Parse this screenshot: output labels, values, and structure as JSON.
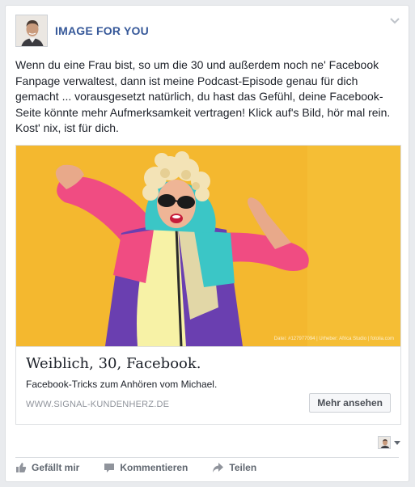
{
  "post": {
    "page_name": "IMAGE FOR YOU",
    "text": "Wenn du eine Frau bist, so um die 30 und außerdem noch ne' Facebook Fanpage verwaltest, dann ist meine Podcast-Episode genau für dich gemacht ... vorausgesetzt natürlich, du hast das Gefühl, deine Facebook-Seite könnte mehr Aufmerksamkeit vertragen! Klick auf's Bild, hör mal rein. Kost' nix, ist für dich."
  },
  "attachment": {
    "image_credit": "Datei: #127977094 | Urheber: Africa Studio | fotolia.com",
    "title": "Weiblich, 30, Facebook.",
    "description": "Facebook-Tricks zum Anhören vom Michael.",
    "domain": "WWW.SIGNAL-KUNDENHERZ.DE",
    "cta_label": "Mehr ansehen"
  },
  "actions": [
    {
      "label": "Gefällt mir",
      "icon": "like-icon"
    },
    {
      "label": "Kommentieren",
      "icon": "comment-icon"
    },
    {
      "label": "Teilen",
      "icon": "share-icon"
    }
  ],
  "colors": {
    "link": "#365899",
    "photo_background": "#f4b82f",
    "muted": "#606770"
  }
}
